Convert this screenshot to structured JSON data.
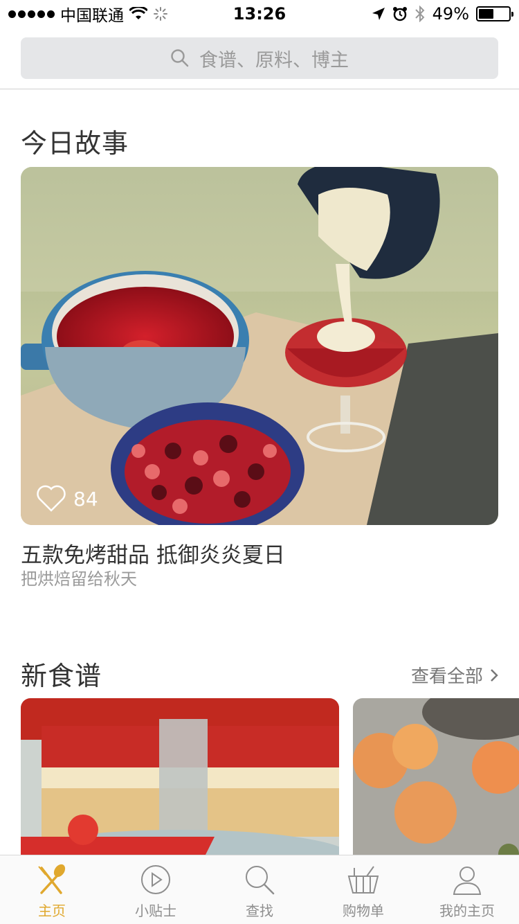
{
  "status_bar": {
    "carrier": "中国联通",
    "time": "13:26",
    "battery_percent": "49%",
    "battery_level": 0.49
  },
  "search": {
    "placeholder": "食谱、原料、博主"
  },
  "today_story": {
    "section_title": "今日故事",
    "like_count": "84",
    "title": "五款免烤甜品 抵御炎炎夏日",
    "subtitle": "把烘焙留给秋天"
  },
  "new_recipes": {
    "section_title": "新食谱",
    "see_all_label": "查看全部"
  },
  "tab_bar": {
    "tabs": [
      {
        "label": "主页",
        "icon": "fork-spoon-icon",
        "active": true
      },
      {
        "label": "小贴士",
        "icon": "play-circle-icon",
        "active": false
      },
      {
        "label": "查找",
        "icon": "search-icon",
        "active": false
      },
      {
        "label": "购物单",
        "icon": "basket-icon",
        "active": false
      },
      {
        "label": "我的主页",
        "icon": "user-icon",
        "active": false
      }
    ]
  },
  "colors": {
    "accent": "#e0a82e",
    "search_bg": "#e5e6e8",
    "tab_inactive": "#8e8e8e"
  }
}
